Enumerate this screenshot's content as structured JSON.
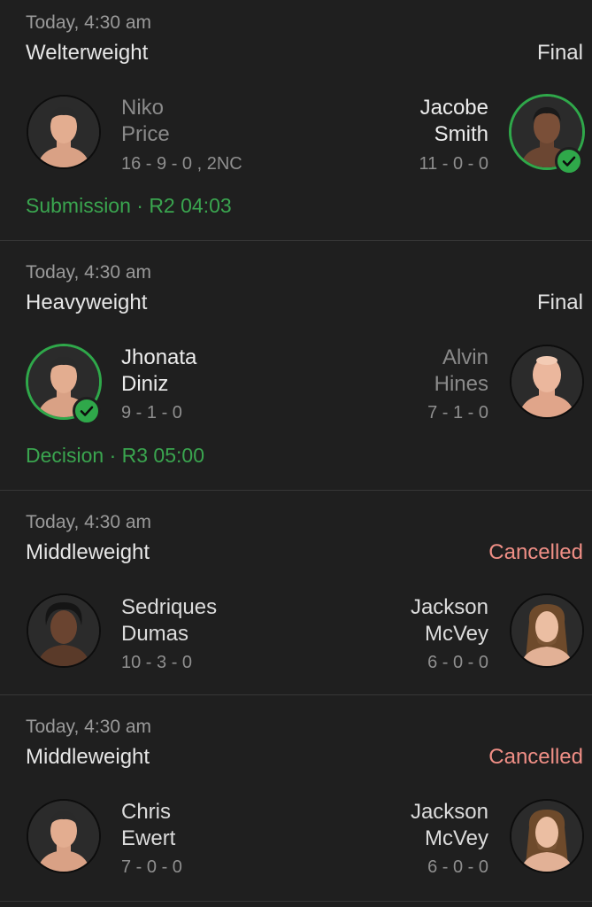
{
  "fights": [
    {
      "time": "Today, 4:30 am",
      "weight_class": "Welterweight",
      "status": "Final",
      "left": {
        "first": "Niko",
        "last": "Price",
        "record": "16 - 9 - 0 , 2NC"
      },
      "right": {
        "first": "Jacobe",
        "last": "Smith",
        "record": "11 - 0 - 0"
      },
      "method": "Submission · R2 04:03"
    },
    {
      "time": "Today, 4:30 am",
      "weight_class": "Heavyweight",
      "status": "Final",
      "left": {
        "first": "Jhonata",
        "last": "Diniz",
        "record": "9 - 1 - 0"
      },
      "right": {
        "first": "Alvin",
        "last": "Hines",
        "record": "7 - 1 - 0"
      },
      "method": "Decision · R3 05:00"
    },
    {
      "time": "Today, 4:30 am",
      "weight_class": "Middleweight",
      "status": "Cancelled",
      "left": {
        "first": "Sedriques",
        "last": "Dumas",
        "record": "10 - 3 - 0"
      },
      "right": {
        "first": "Jackson",
        "last": "McVey",
        "record": "6 - 0 - 0"
      }
    },
    {
      "time": "Today, 4:30 am",
      "weight_class": "Middleweight",
      "status": "Cancelled",
      "left": {
        "first": "Chris",
        "last": "Ewert",
        "record": "7 - 0 - 0"
      },
      "right": {
        "first": "Jackson",
        "last": "McVey",
        "record": "6 - 0 - 0"
      }
    }
  ],
  "colors": {
    "background": "#1f1f1f",
    "win_green": "#2fa84a",
    "method_green": "#3aa54f",
    "cancelled": "#f08f86"
  },
  "icons": [
    "fighter-avatar-icon",
    "winner-check-icon"
  ]
}
